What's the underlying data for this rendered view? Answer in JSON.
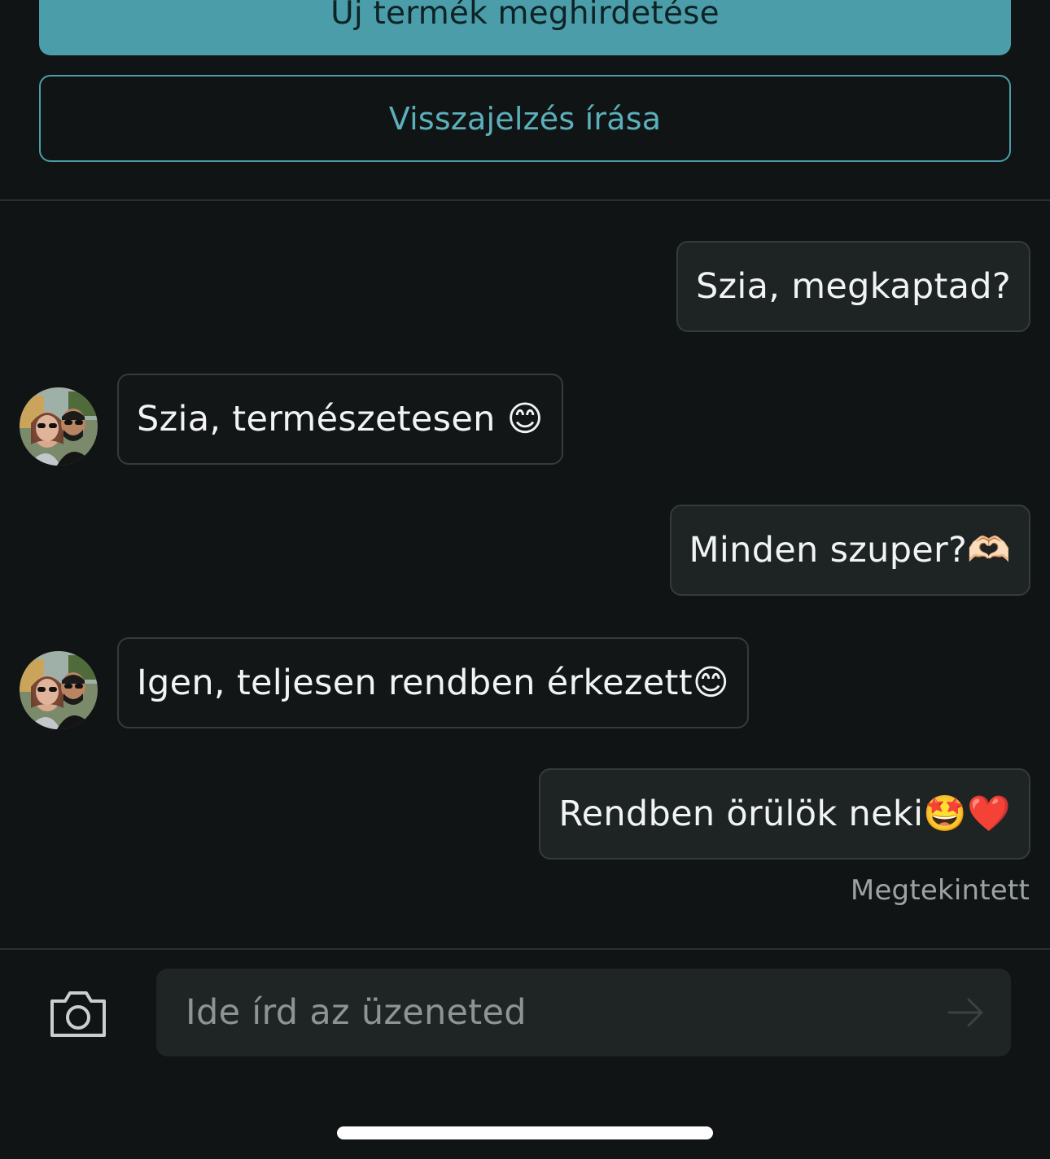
{
  "header": {
    "new_listing_label": "Új termék meghirdetése",
    "feedback_label": "Visszajelzés írása"
  },
  "messages": [
    {
      "direction": "outgoing",
      "text": "Szia, megkaptad?"
    },
    {
      "direction": "incoming",
      "text": "Szia, természetesen 😊"
    },
    {
      "direction": "outgoing",
      "text": "Minden szuper?🫶🏻"
    },
    {
      "direction": "incoming",
      "text": "Igen, teljesen rendben érkezett😊"
    },
    {
      "direction": "outgoing",
      "text": "Rendben örülök neki🤩❤️"
    }
  ],
  "status": {
    "seen_label": "Megtekintett"
  },
  "composer": {
    "placeholder": "Ide írd az üzeneted",
    "camera_icon": "camera-icon",
    "send_icon": "arrow-right-icon"
  },
  "colors": {
    "background": "#111415",
    "accent": "#4b9ea9",
    "bubble": "#1e2324",
    "bubble_border": "#343b3c"
  }
}
